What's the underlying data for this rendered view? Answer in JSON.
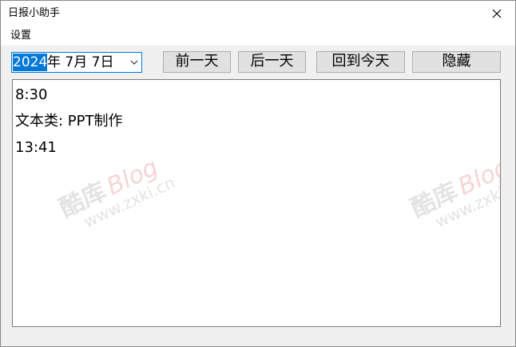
{
  "window": {
    "title": "日报小助手"
  },
  "menu": {
    "settings_label": "设置"
  },
  "toolbar": {
    "date_year": "2024",
    "date_rest": "年  7月  7日",
    "prev_day_label": "前一天",
    "next_day_label": "后一天",
    "today_label": "回到今天",
    "hide_label": "隐藏"
  },
  "content": {
    "lines": [
      "8:30",
      "文本类: PPT制作",
      "13:41"
    ]
  },
  "watermark": {
    "cn": "酷库",
    "blog": "Blog",
    "url": "www.zxki.cn"
  },
  "colors": {
    "accent": "#0078d7",
    "button_bg": "#e1e1e1",
    "button_border": "#adadad",
    "window_bg": "#f0f0f0"
  },
  "icons": {
    "close": "close-icon",
    "dropdown": "chevron-down-icon"
  }
}
